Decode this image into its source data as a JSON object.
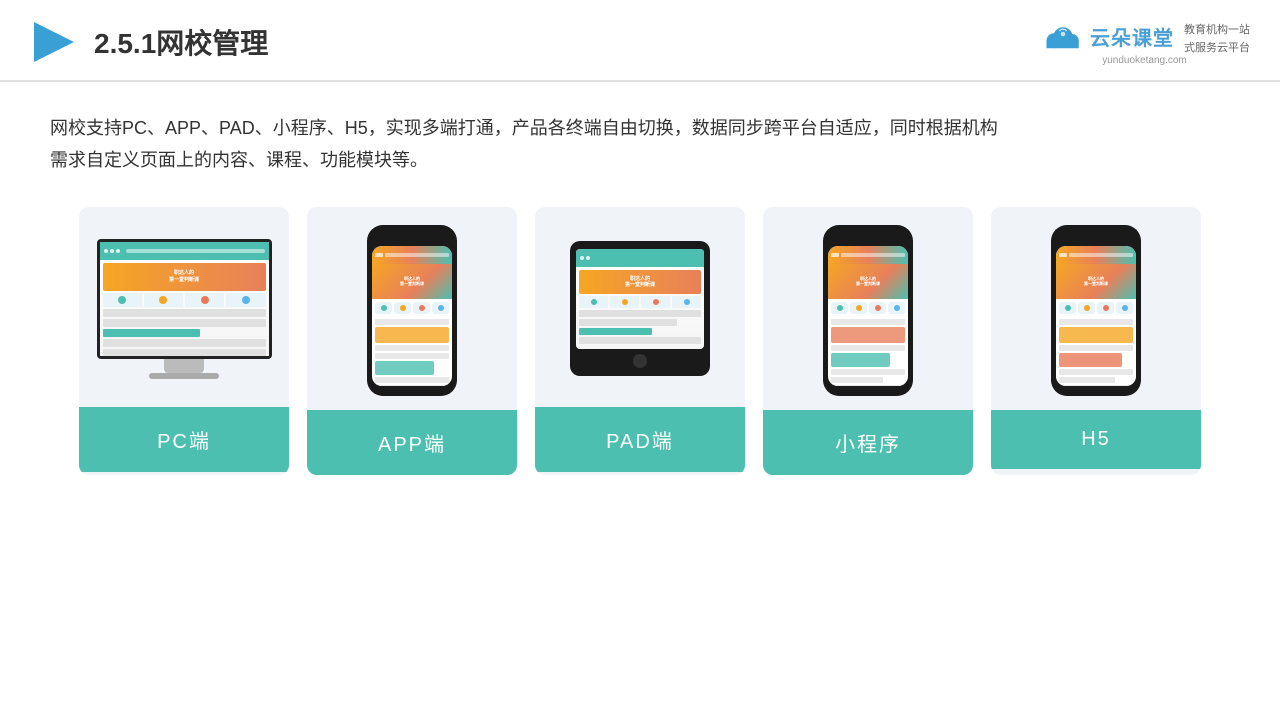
{
  "header": {
    "title": "2.5.1网校管理",
    "logo_main": "云朵课堂",
    "logo_url": "yunduoketang.com",
    "logo_tagline_line1": "教育机构一站",
    "logo_tagline_line2": "式服务云平台"
  },
  "description": {
    "text_line1": "网校支持PC、APP、PAD、小程序、H5，实现多端打通，产品各终端自由切换，数据同步跨平台自适应，同时根据机构",
    "text_line2": "需求自定义页面上的内容、课程、功能模块等。"
  },
  "cards": [
    {
      "id": "pc",
      "label": "PC端"
    },
    {
      "id": "app",
      "label": "APP端"
    },
    {
      "id": "pad",
      "label": "PAD端"
    },
    {
      "id": "miniprogram",
      "label": "小程序"
    },
    {
      "id": "h5",
      "label": "H5"
    }
  ],
  "colors": {
    "teal": "#4cbfb0",
    "accent_orange": "#f5a623",
    "bg_card": "#f0f4f8",
    "text_dark": "#333333",
    "border": "#e0e0e0"
  }
}
